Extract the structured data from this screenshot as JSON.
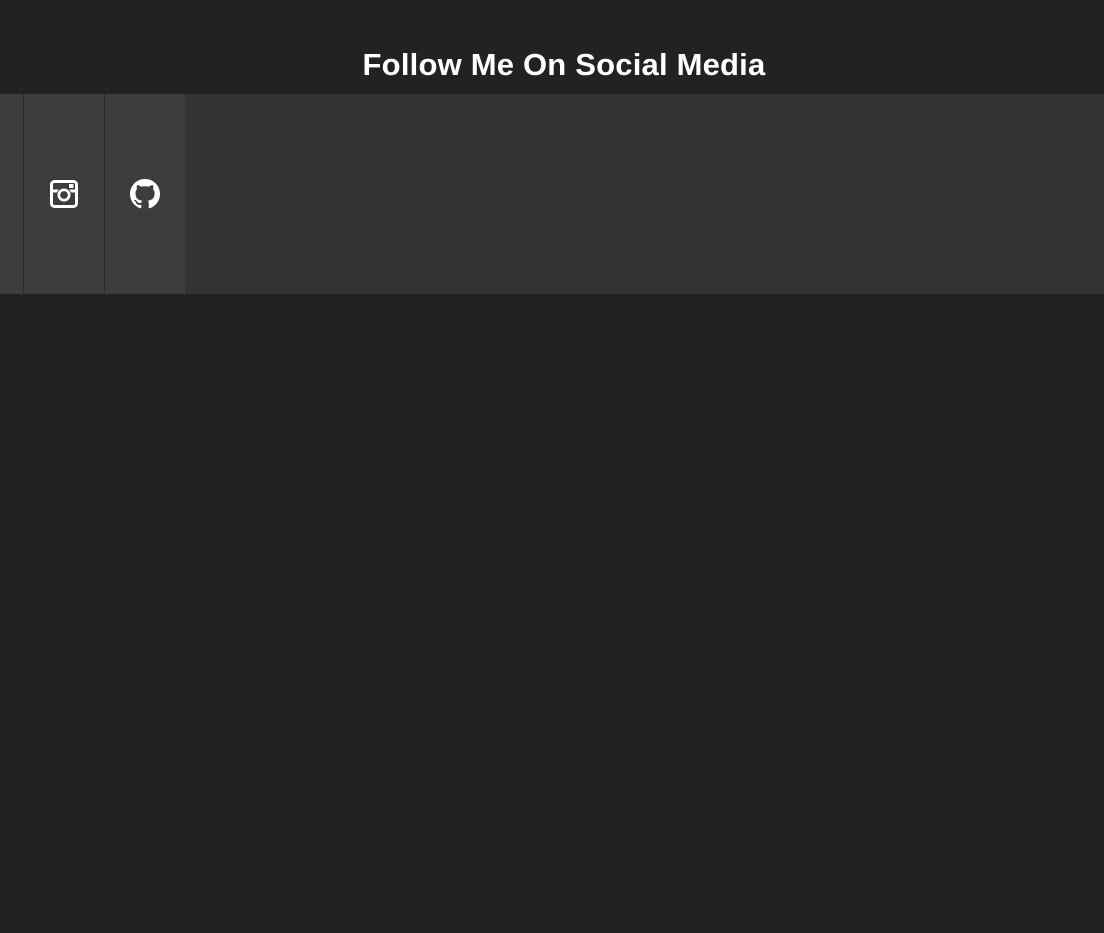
{
  "header": {
    "title": "Follow Me On Social Media"
  },
  "social_links": [
    {
      "icon": "instagram-icon"
    },
    {
      "icon": "github-icon"
    }
  ],
  "colors": {
    "background": "#222222",
    "bar": "#333333",
    "tile": "#3d3d3d",
    "icon": "#ffffff"
  }
}
